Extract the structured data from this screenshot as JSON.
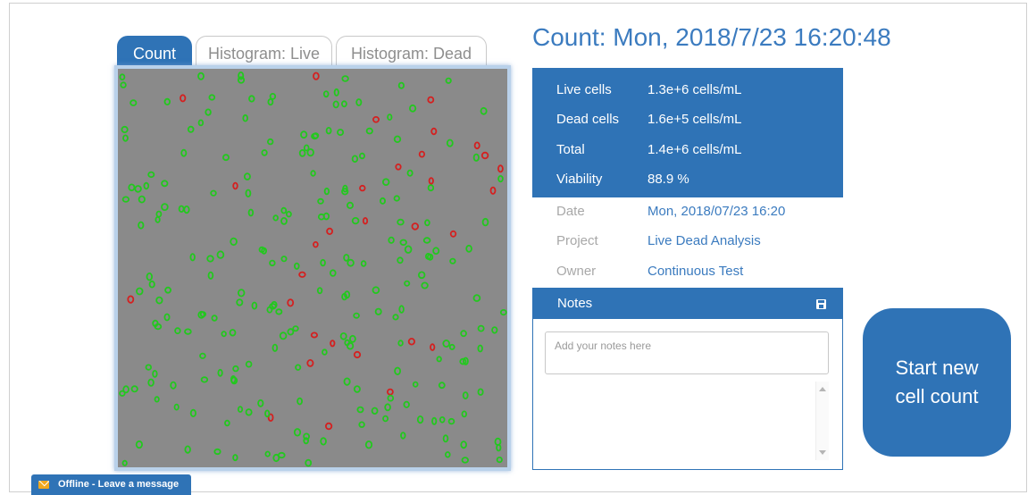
{
  "tabs": [
    {
      "label": "Count",
      "active": true
    },
    {
      "label": "Histogram: Live",
      "active": false
    },
    {
      "label": "Histogram: Dead",
      "active": false
    }
  ],
  "count_title": "Count: Mon, 2018/7/23 16:20:48",
  "stats": [
    {
      "label": "Live cells",
      "value": "1.3e+6 cells/mL"
    },
    {
      "label": "Dead cells",
      "value": "1.6e+5 cells/mL"
    },
    {
      "label": "Total",
      "value": "1.4e+6 cells/mL"
    },
    {
      "label": "Viability",
      "value": "88.9 %"
    }
  ],
  "meta": [
    {
      "label": "Date",
      "value": "Mon, 2018/07/23 16:20"
    },
    {
      "label": "Project",
      "value": "Live Dead Analysis"
    },
    {
      "label": "Owner",
      "value": "Continuous Test"
    }
  ],
  "notes": {
    "title": "Notes",
    "placeholder": "Add your notes here",
    "value": ""
  },
  "start_button": {
    "label": "Start new cell count"
  },
  "offline": {
    "label": "Offline - Leave a message"
  },
  "colors": {
    "accent": "#2f73b6",
    "title_blue": "#3b7bbf",
    "live_cell": "#22c81e",
    "dead_cell": "#d42020",
    "image_background": "#8a8a8a",
    "mail_icon": "#f0a81e"
  },
  "icons": [
    "save-icon",
    "mail-icon",
    "scroll-up-icon",
    "scroll-down-icon"
  ]
}
